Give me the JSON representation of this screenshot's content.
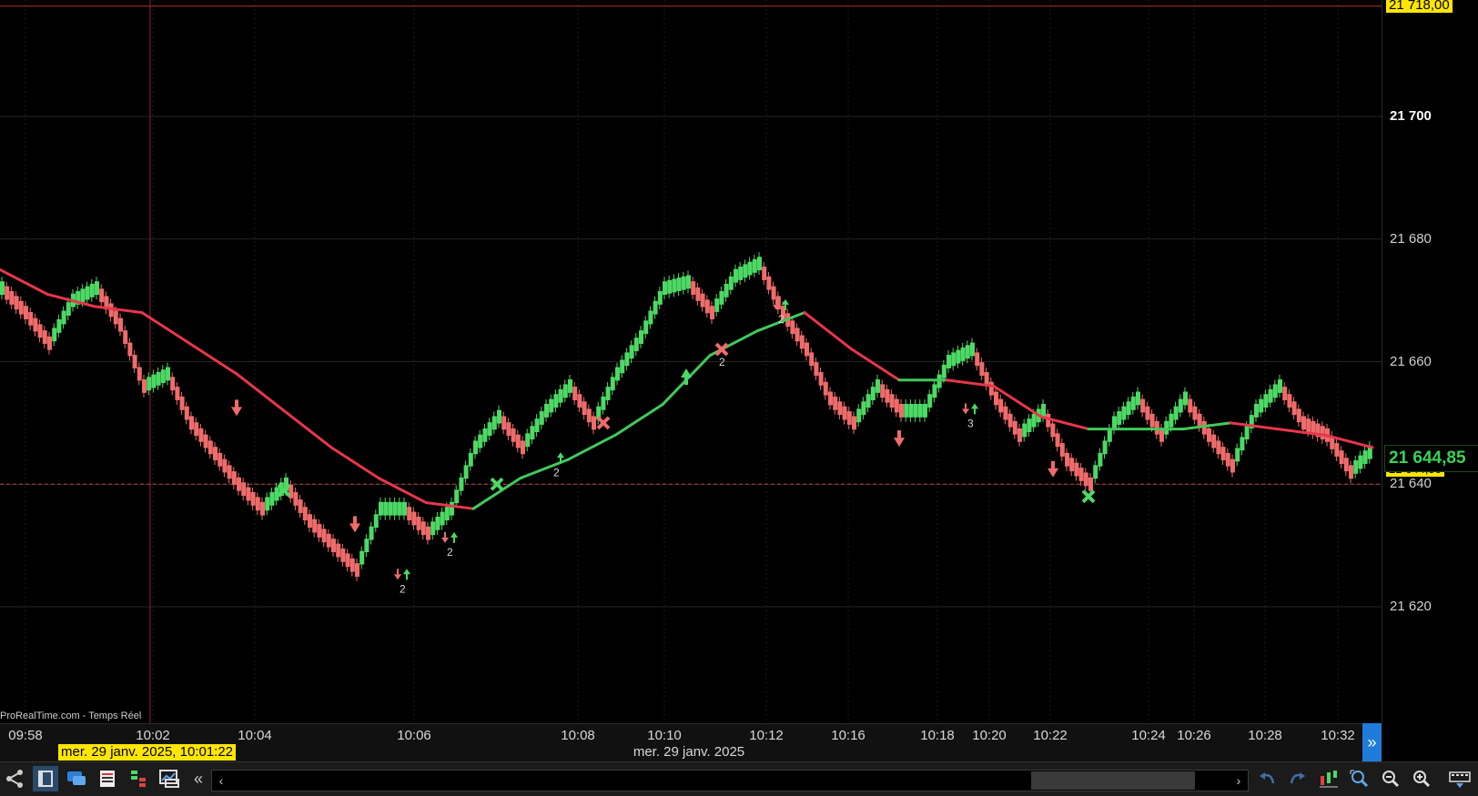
{
  "app": {
    "watermark": "ProRealTime.com - Temps Réel",
    "cursor_date": "mer. 29 janv. 2025, 10:01:22",
    "time_axis_date": "mer. 29 janv. 2025"
  },
  "colors": {
    "up": "#4cd964",
    "down": "#f06b6b",
    "ma_down": "#e8364a",
    "ma_up": "#41c95a",
    "badge_yellow": "#ffe600",
    "scroll_accent": "#1e7cd8"
  },
  "price_axis": {
    "ticks": [
      {
        "label": "21 700",
        "value": 21700,
        "bold": true
      },
      {
        "label": "21 680",
        "value": 21680,
        "bold": false
      },
      {
        "label": "21 660",
        "value": 21660,
        "bold": false
      },
      {
        "label": "21 640",
        "value": 21640,
        "bold": false
      },
      {
        "label": "21 620",
        "value": 21620,
        "bold": false
      }
    ],
    "top_badge": "21 718,00",
    "current_price": "21 644,85",
    "low_badge": "21 644,50"
  },
  "chart_data": {
    "type": "line",
    "y_range": [
      21601,
      21719
    ],
    "x_ticks": [
      "09:58",
      "10:02",
      "10:04",
      "10:06",
      "10:08",
      "10:10",
      "10:12",
      "10:16",
      "10:18",
      "10:20",
      "10:22",
      "10:24",
      "10:26",
      "10:28",
      "10:32"
    ],
    "cursor_value": 21718,
    "reference_line": 21640,
    "price_path": [
      [
        0,
        21672
      ],
      [
        1,
        21668
      ],
      [
        2,
        21663
      ],
      [
        3,
        21670
      ],
      [
        4,
        21672
      ],
      [
        5,
        21666
      ],
      [
        6,
        21656
      ],
      [
        7,
        21658
      ],
      [
        8,
        21650
      ],
      [
        9,
        21645
      ],
      [
        10,
        21640
      ],
      [
        11,
        21636
      ],
      [
        12,
        21640
      ],
      [
        13,
        21634
      ],
      [
        14,
        21630
      ],
      [
        15,
        21626
      ],
      [
        16,
        21636
      ],
      [
        17,
        21636
      ],
      [
        18,
        21632
      ],
      [
        19,
        21636
      ],
      [
        20,
        21646
      ],
      [
        21,
        21651
      ],
      [
        22,
        21646
      ],
      [
        23,
        21652
      ],
      [
        24,
        21656
      ],
      [
        25,
        21650
      ],
      [
        26,
        21658
      ],
      [
        27,
        21664
      ],
      [
        28,
        21672
      ],
      [
        29,
        21673
      ],
      [
        30,
        21668
      ],
      [
        31,
        21674
      ],
      [
        32,
        21676
      ],
      [
        33,
        21668
      ],
      [
        34,
        21662
      ],
      [
        35,
        21654
      ],
      [
        36,
        21650
      ],
      [
        37,
        21656
      ],
      [
        38,
        21652
      ],
      [
        39,
        21652
      ],
      [
        40,
        21660
      ],
      [
        41,
        21662
      ],
      [
        42,
        21654
      ],
      [
        43,
        21648
      ],
      [
        44,
        21652
      ],
      [
        45,
        21644
      ],
      [
        46,
        21640
      ],
      [
        47,
        21650
      ],
      [
        48,
        21654
      ],
      [
        49,
        21648
      ],
      [
        50,
        21654
      ],
      [
        51,
        21648
      ],
      [
        52,
        21643
      ],
      [
        53,
        21652
      ],
      [
        54,
        21656
      ],
      [
        55,
        21650
      ],
      [
        56,
        21648
      ],
      [
        57,
        21642
      ],
      [
        58,
        21646
      ]
    ],
    "moving_average": [
      [
        0,
        21675
      ],
      [
        2,
        21671
      ],
      [
        4,
        21669
      ],
      [
        6,
        21668
      ],
      [
        8,
        21663
      ],
      [
        10,
        21658
      ],
      [
        12,
        21652
      ],
      [
        14,
        21646
      ],
      [
        16,
        21641
      ],
      [
        18,
        21637
      ],
      [
        20,
        21636
      ],
      [
        22,
        21641
      ],
      [
        24,
        21644
      ],
      [
        26,
        21648
      ],
      [
        28,
        21653
      ],
      [
        30,
        21661
      ],
      [
        32,
        21665
      ],
      [
        34,
        21668
      ],
      [
        36,
        21662
      ],
      [
        38,
        21657
      ],
      [
        40,
        21657
      ],
      [
        42,
        21656
      ],
      [
        44,
        21651
      ],
      [
        46,
        21649
      ],
      [
        48,
        21649
      ],
      [
        50,
        21649
      ],
      [
        52,
        21650
      ],
      [
        54,
        21649
      ],
      [
        56,
        21648
      ],
      [
        58,
        21646
      ]
    ],
    "signals": [
      {
        "type": "down-arrow",
        "x": 10,
        "y": 21652,
        "label": ""
      },
      {
        "type": "cross-green",
        "x": 12,
        "y": 21639,
        "label": ""
      },
      {
        "type": "down-arrow",
        "x": 15,
        "y": 21633,
        "label": ""
      },
      {
        "type": "double-arrow",
        "x": 17,
        "y": 21625,
        "label": "2"
      },
      {
        "type": "double-arrow",
        "x": 19,
        "y": 21631,
        "label": "2"
      },
      {
        "type": "cross-green",
        "x": 21,
        "y": 21640,
        "label": ""
      },
      {
        "type": "up-arrow-label",
        "x": 23.5,
        "y": 21644,
        "label": "2"
      },
      {
        "type": "cross-red",
        "x": 25.5,
        "y": 21650,
        "label": ""
      },
      {
        "type": "up-arrow",
        "x": 29,
        "y": 21658,
        "label": ""
      },
      {
        "type": "cross-red",
        "x": 30.5,
        "y": 21662,
        "label": "2"
      },
      {
        "type": "double-arrow",
        "x": 33,
        "y": 21669,
        "label": "2"
      },
      {
        "type": "down-arrow",
        "x": 38,
        "y": 21647,
        "label": ""
      },
      {
        "type": "double-arrow",
        "x": 41,
        "y": 21652,
        "label": "3"
      },
      {
        "type": "down-arrow",
        "x": 44.5,
        "y": 21642,
        "label": ""
      },
      {
        "type": "cross-green",
        "x": 46,
        "y": 21638,
        "label": ""
      }
    ]
  }
}
